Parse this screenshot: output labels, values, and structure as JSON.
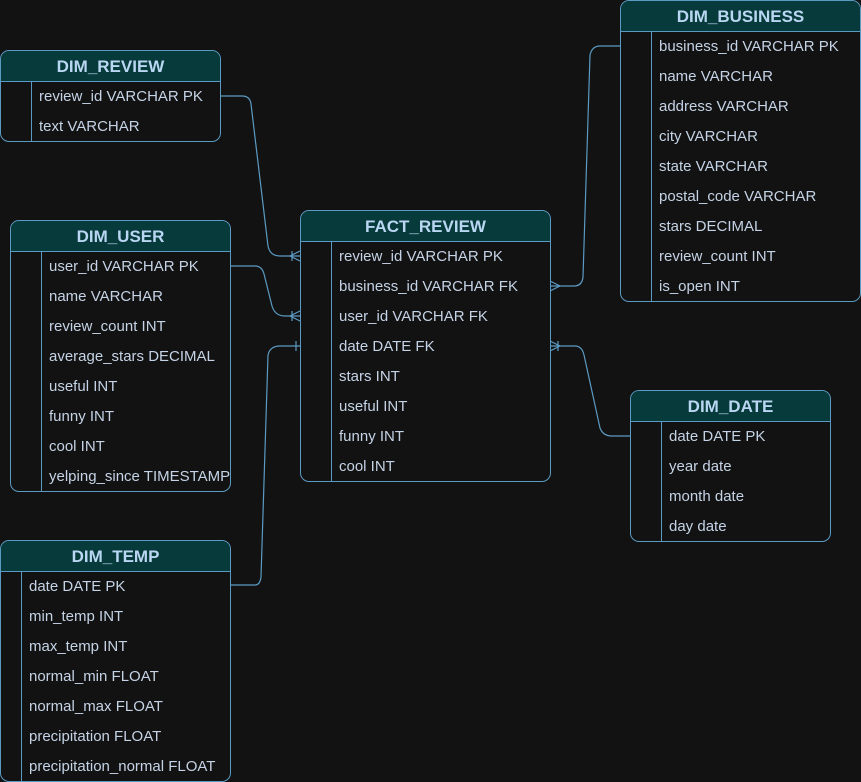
{
  "colors": {
    "background": "#121212",
    "header": "#073a3a",
    "border": "#5b9ac3",
    "text": "#c5d3e6",
    "title": "#b9d6f2"
  },
  "tables": [
    {
      "id": "dim_review",
      "title": "DIM_REVIEW",
      "columns": [
        "review_id VARCHAR PK",
        "text VARCHAR"
      ]
    },
    {
      "id": "dim_user",
      "title": "DIM_USER",
      "columns": [
        "user_id VARCHAR PK",
        "name VARCHAR",
        "review_count INT",
        "average_stars DECIMAL",
        "useful INT",
        "funny INT",
        "cool INT",
        "yelping_since TIMESTAMP"
      ]
    },
    {
      "id": "dim_temp",
      "title": "DIM_TEMP",
      "columns": [
        "date DATE PK",
        "min_temp INT",
        "max_temp INT",
        "normal_min FLOAT",
        "normal_max FLOAT",
        "precipitation FLOAT",
        "precipitation_normal FLOAT"
      ]
    },
    {
      "id": "fact_review",
      "title": "FACT_REVIEW",
      "columns": [
        "review_id VARCHAR PK",
        "business_id VARCHAR FK",
        "user_id VARCHAR FK",
        "date DATE FK",
        "stars INT",
        "useful INT",
        "funny INT",
        "cool INT"
      ]
    },
    {
      "id": "dim_business",
      "title": "DIM_BUSINESS",
      "columns": [
        "business_id VARCHAR PK",
        "name VARCHAR",
        "address VARCHAR",
        "city VARCHAR",
        "state VARCHAR",
        "postal_code VARCHAR",
        "stars DECIMAL",
        "review_count INT",
        "is_open INT"
      ]
    },
    {
      "id": "dim_date",
      "title": "DIM_DATE",
      "columns": [
        "date DATE PK",
        "year date",
        "month date",
        "day date"
      ]
    }
  ],
  "relationships": [
    {
      "from": "dim_review.review_id",
      "to": "fact_review.review_id",
      "to_end": "one-or-many"
    },
    {
      "from": "dim_user.user_id",
      "to": "fact_review.user_id",
      "to_end": "one-or-many"
    },
    {
      "from": "dim_temp.date",
      "to": "fact_review.date",
      "to_end": "one"
    },
    {
      "from": "dim_business.business_id",
      "to": "fact_review.business_id",
      "to_end": "many"
    },
    {
      "from": "dim_date.date",
      "to": "fact_review.date",
      "to_end": "one-or-many"
    }
  ]
}
